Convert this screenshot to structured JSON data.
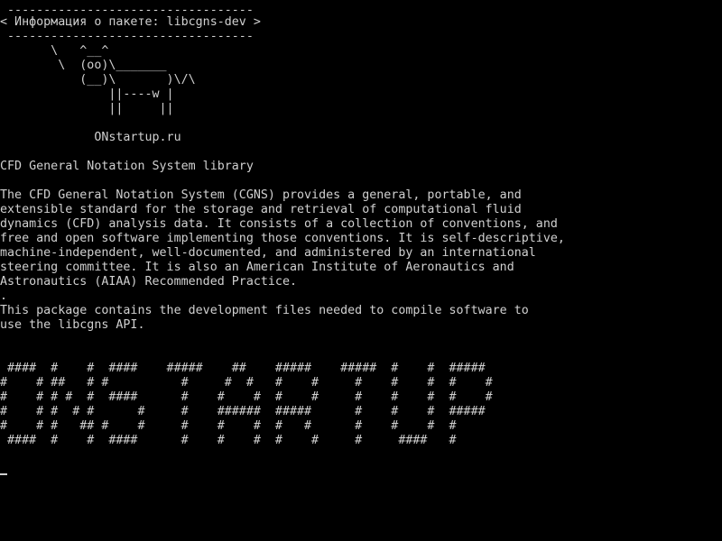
{
  "terminal": {
    "fg_color": "#d0d0d0",
    "bg_color": "#000000",
    "lines": [
      " ----------------------------------",
      "< Информация о пакете: libcgns-dev >",
      " ----------------------------------",
      "       \\   ^__^",
      "        \\  (oo)\\_______",
      "           (__)\\       )\\/\\",
      "               ||----w |",
      "               ||     ||",
      "",
      "             ONstartup.ru",
      "",
      "CFD General Notation System library",
      "",
      "The CFD General Notation System (CGNS) provides a general, portable, and",
      "extensible standard for the storage and retrieval of computational fluid",
      "dynamics (CFD) analysis data. It consists of a collection of conventions, and",
      "free and open software implementing those conventions. It is self-descriptive,",
      "machine-independent, well-documented, and administered by an international",
      "steering committee. It is also an American Institute of Aeronautics and",
      "Astronautics (AIAA) Recommended Practice.",
      ".",
      "This package contains the development files needed to compile software to",
      "use the libcgns API.",
      "",
      "",
      " ####  #    #  ####    #####    ##    #####    #####  #    #  #####",
      "#    # ##   # #          #     #  #   #    #     #    #    #  #    #",
      "#    # # #  #  ####      #    #    #  #    #     #    #    #  #    #",
      "#    # #  # #      #     #    ######  #####      #    #    #  #####",
      "#    # #   ## #    #     #    #    #  #   #      #    #    #  #",
      " ####  #    #  ####      #    #    #  #    #     #     ####   #"
    ]
  }
}
